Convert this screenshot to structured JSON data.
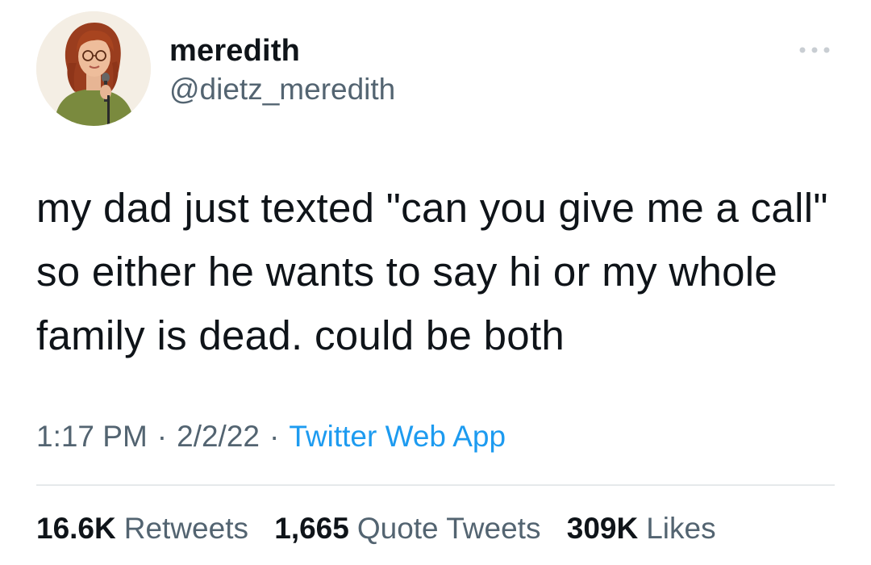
{
  "author": {
    "display_name": "meredith",
    "handle": "@dietz_meredith",
    "avatar": "profile-photo"
  },
  "tweet": {
    "text": "my dad just texted \"can you give me a call\" so either he wants to say hi or my whole family is dead. could be both"
  },
  "meta": {
    "time": "1:17 PM",
    "date": "2/2/22",
    "separator": "·",
    "source": "Twitter Web App"
  },
  "stats": {
    "retweets": {
      "count": "16.6K",
      "label": "Retweets"
    },
    "quote_tweets": {
      "count": "1,665",
      "label": "Quote Tweets"
    },
    "likes": {
      "count": "309K",
      "label": "Likes"
    }
  },
  "icons": {
    "more": "more-horizontal-icon"
  },
  "colors": {
    "text": "#0f1419",
    "secondary": "#536471",
    "link": "#1d9bf0",
    "divider": "#e6e9eb"
  }
}
